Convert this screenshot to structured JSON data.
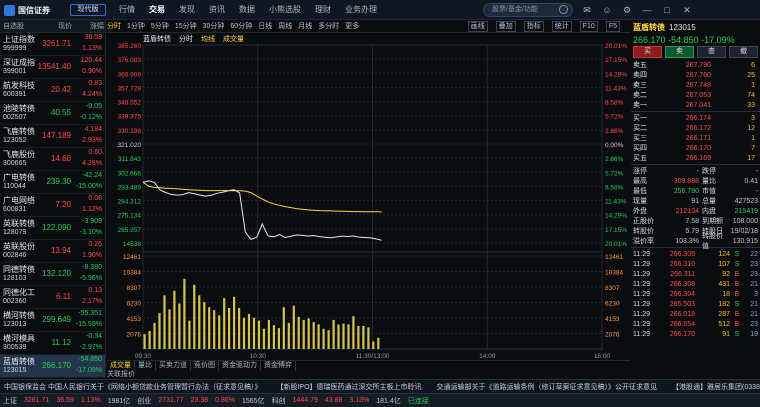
{
  "brand": "国信证券",
  "version_label": "现代版",
  "menu": [
    "行情",
    "交易",
    "发现",
    "资讯",
    "数据",
    "小熊选股",
    "理财",
    "业务办理"
  ],
  "search_placeholder": "股票/基金/功能",
  "watchlist": {
    "title": "自选股",
    "price_col": "现价",
    "change_col": "涨幅",
    "rows": [
      {
        "name": "上证指数",
        "code": "999999",
        "price": "3261.71",
        "change": "36.59",
        "pct": "1.13%",
        "dir": "up"
      },
      {
        "name": "深证成指",
        "code": "399001",
        "price": "13541.40",
        "change": "120.44",
        "pct": "0.90%",
        "dir": "up"
      },
      {
        "name": "航发科技",
        "code": "600391",
        "price": "20.42",
        "change": "0.83",
        "pct": "4.24%",
        "dir": "up"
      },
      {
        "name": "池陵转债",
        "code": "002507",
        "price": "40.55",
        "change": "-0.05",
        "pct": "-0.12%",
        "dir": "dn"
      },
      {
        "name": "飞鹿转债",
        "code": "123052",
        "price": "147.189",
        "change": "4.184",
        "pct": "2.93%",
        "dir": "up"
      },
      {
        "name": "飞鹿股份",
        "code": "300665",
        "price": "14.60",
        "change": "0.60",
        "pct": "4.28%",
        "dir": "up"
      },
      {
        "name": "广电转债",
        "code": "110044",
        "price": "239.30",
        "change": "-42.24",
        "pct": "-15.00%",
        "dir": "dn"
      },
      {
        "name": "广电网络",
        "code": "600831",
        "price": "7.20",
        "change": "0.08",
        "pct": "1.12%",
        "dir": "up"
      },
      {
        "name": "英联转债",
        "code": "128079",
        "price": "122.090",
        "change": "-3.909",
        "pct": "-3.10%",
        "dir": "dn"
      },
      {
        "name": "英联股份",
        "code": "002846",
        "price": "13.94",
        "change": "0.26",
        "pct": "1.90%",
        "dir": "up"
      },
      {
        "name": "同德转债",
        "code": "128103",
        "price": "132.120",
        "change": "-8.380",
        "pct": "-5.96%",
        "dir": "dn"
      },
      {
        "name": "同德化工",
        "code": "002360",
        "price": "6.11",
        "change": "0.13",
        "pct": "2.17%",
        "dir": "up"
      },
      {
        "name": "横河转债",
        "code": "123013",
        "price": "299.649",
        "change": "-55.351",
        "pct": "-15.59%",
        "dir": "dn"
      },
      {
        "name": "横河模具",
        "code": "300539",
        "price": "11.12",
        "change": "-0.34",
        "pct": "-2.97%",
        "dir": "dn"
      },
      {
        "name": "蓝盾转债",
        "code": "123015",
        "price": "266.170",
        "change": "-54.850",
        "pct": "-17.09%",
        "dir": "dn"
      }
    ]
  },
  "chart_toolbar": {
    "items": [
      "分时",
      "1分钟",
      "5分钟",
      "15分钟",
      "30分钟",
      "60分钟",
      "日线",
      "周线",
      "月线",
      "多分时",
      "更多"
    ],
    "right": [
      "画线",
      "叠加",
      "指标",
      "统计",
      "F10",
      "F5"
    ]
  },
  "chart_head": {
    "name": "蓝盾转债",
    "type": "分时",
    "avg": "均线",
    "vol": "成交量"
  },
  "chart_data": {
    "type": "line",
    "x_ticks": [
      "09:30",
      "10:30",
      "11:30",
      "13:00",
      "14:00",
      "15:00"
    ],
    "y_left": [
      "385.260",
      "376.083",
      "366.906",
      "357.729",
      "348.552",
      "339.375",
      "330.198",
      "321.020",
      "311.843",
      "302.666",
      "293.489",
      "284.312",
      "275.134",
      "265.957",
      "14538"
    ],
    "y_right": [
      "20.01%",
      "17.15%",
      "14.29%",
      "11.43%",
      "8.58%",
      "5.72%",
      "2.86%",
      "0.00%",
      "2.86%",
      "5.72%",
      "8.58%",
      "11.43%",
      "14.29%",
      "17.15%",
      "20.01%"
    ],
    "vol_ticks": [
      "12461",
      "10384",
      "8307",
      "6230",
      "4153",
      "2076"
    ],
    "price": [
      302.6,
      303.4,
      302.5,
      297.9,
      296.4,
      295.2,
      294.8,
      295.1,
      296.3,
      295.7,
      294.9,
      294.2,
      294.7,
      295.9,
      296.5,
      297.4,
      298.1,
      296.2,
      272.5,
      268.1,
      269.4,
      277.4,
      270.3,
      269.7,
      271.0,
      269.3,
      270.0,
      270.8,
      270.6,
      270.1,
      270.5,
      269.8,
      269.4,
      269.1,
      269.6,
      270.1,
      269.9,
      270.2,
      269.5,
      269.3,
      269.1,
      268.4,
      267.6
    ],
    "avg": [
      302.6,
      300.1,
      299.4,
      299.2,
      299.0,
      298.8,
      298.6,
      298.3,
      298.1,
      297.9,
      297.7,
      297.5,
      297.5,
      297.5,
      297.5,
      297.5,
      297.4,
      297.4,
      297.2,
      296.3,
      294.3,
      292.4,
      290.8,
      289.6,
      288.7,
      287.9,
      287.3,
      286.7,
      286.3,
      285.9,
      285.7,
      285.5,
      285.4,
      285.3,
      285.2,
      285.1,
      285.0,
      284.9,
      284.9,
      284.8,
      284.8,
      284.8,
      284.7
    ],
    "volume": [
      2000,
      2400,
      3500,
      4800,
      7200,
      5300,
      7800,
      6100,
      9400,
      3800,
      8600,
      7200,
      6300,
      5600,
      5200,
      4500,
      6800,
      5500,
      7000,
      5500,
      4200,
      4700,
      4200,
      3800,
      2700,
      3900,
      3200,
      2800,
      5600,
      3500,
      5800,
      4300,
      3900,
      4100,
      3600,
      3300,
      2700,
      2500,
      3900,
      3300,
      3400,
      3300,
      4400,
      3100,
      3100,
      2900,
      1000,
      1500
    ]
  },
  "bottom_tabs": [
    "成交量",
    "量比",
    "买卖力道",
    "竞价图",
    "资金驱动力",
    "资金博弈"
  ],
  "bottom_mini": "关联报价",
  "quote": {
    "name": "蓝盾转债",
    "code": "123015",
    "price": "266.170",
    "change": "-54.850",
    "pct": "-17.09%",
    "buttons": [
      "买",
      "卖",
      "查",
      "撤"
    ],
    "asks": [
      [
        "卖五",
        "267.790",
        "6"
      ],
      [
        "卖四",
        "267.760",
        "25"
      ],
      [
        "卖三",
        "267.748",
        "1"
      ],
      [
        "卖二",
        "267.053",
        "74"
      ],
      [
        "卖一",
        "267.041",
        "33"
      ]
    ],
    "bids": [
      [
        "买一",
        "266.174",
        "3"
      ],
      [
        "买二",
        "266.172",
        "12"
      ],
      [
        "买三",
        "266.171",
        "1"
      ],
      [
        "买四",
        "266.170",
        "7"
      ],
      [
        "买五",
        "266.169",
        "17"
      ]
    ],
    "info": [
      [
        "涨停",
        "-",
        "跌停",
        "-"
      ],
      [
        "最高",
        "309.888",
        "量比",
        "0.41"
      ],
      [
        "最低",
        "256.780",
        "市值",
        "-"
      ],
      [
        "现量",
        "91",
        "总量",
        "427523"
      ],
      [
        "外盘",
        "212104",
        "内盘",
        "215419"
      ],
      [
        "正股价",
        "7.58",
        "到期额",
        "108.000"
      ],
      [
        "转股价",
        "5.79",
        "转股日",
        "19/02/18"
      ],
      [
        "溢价率",
        "103.3%",
        "转股价值",
        "130.915"
      ]
    ],
    "ticks": [
      [
        "11:29",
        "266.305",
        "124",
        "S",
        "22"
      ],
      [
        "11:29",
        "266.310",
        "107",
        "S",
        "23"
      ],
      [
        "11:29",
        "266.311",
        "92",
        "B",
        "23"
      ],
      [
        "11:29",
        "266.308",
        "431",
        "B",
        "21"
      ],
      [
        "11:29",
        "266.304",
        "18",
        "B",
        "3"
      ],
      [
        "11:29",
        "265.503",
        "182",
        "S",
        "21"
      ],
      [
        "11:29",
        "266.018",
        "287",
        "B",
        "21"
      ],
      [
        "11:29",
        "266.654",
        "512",
        "B",
        "23"
      ],
      [
        "11:29",
        "266.170",
        "91",
        "S",
        "19"
      ]
    ]
  },
  "ticker": [
    "中国银保监会 中国人民银行关于《网络小额贷款业务管理暂行办法（征求意见稿）》",
    "【新股IPO】德瑞医药通过深交所主板上市聆讯",
    "交通运输部关于《道路运输条例（修订草案征求意见稿）》公开征求意见",
    "【港股通】雅居乐集团(03383)通过港交所主板上市聆讯"
  ],
  "status": [
    [
      "上证",
      "3261.71",
      "36.59",
      "1.13%",
      "1981亿"
    ],
    [
      "创业",
      "2731.77",
      "23.38",
      "0.86%",
      "1565亿"
    ],
    [
      "科创",
      "1444.79",
      "43.88",
      "3.13%",
      "181.4亿"
    ]
  ],
  "status_conn": "已连接"
}
